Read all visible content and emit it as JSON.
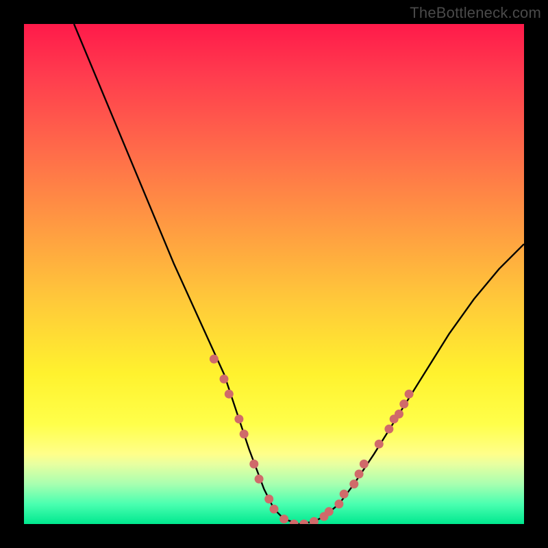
{
  "watermark": "TheBottleneck.com",
  "chart_data": {
    "type": "line",
    "title": "",
    "xlabel": "",
    "ylabel": "",
    "xlim": [
      0,
      100
    ],
    "ylim": [
      0,
      100
    ],
    "series": [
      {
        "name": "curve",
        "x": [
          10,
          15,
          20,
          25,
          30,
          35,
          40,
          45,
          48,
          50,
          52,
          55,
          58,
          60,
          63,
          66,
          70,
          75,
          80,
          85,
          90,
          95,
          100
        ],
        "y": [
          100,
          88,
          76,
          64,
          52,
          41,
          30,
          15,
          7,
          3,
          1,
          0,
          0.5,
          1.5,
          4,
          8,
          14,
          22,
          30,
          38,
          45,
          51,
          56
        ]
      }
    ],
    "scatter": {
      "name": "highlighted-points",
      "color": "#d06a6a",
      "points": [
        {
          "x": 38,
          "y": 33
        },
        {
          "x": 40,
          "y": 29
        },
        {
          "x": 41,
          "y": 26
        },
        {
          "x": 43,
          "y": 21
        },
        {
          "x": 44,
          "y": 18
        },
        {
          "x": 46,
          "y": 12
        },
        {
          "x": 47,
          "y": 9
        },
        {
          "x": 49,
          "y": 5
        },
        {
          "x": 50,
          "y": 3
        },
        {
          "x": 52,
          "y": 1
        },
        {
          "x": 54,
          "y": 0
        },
        {
          "x": 56,
          "y": 0
        },
        {
          "x": 58,
          "y": 0.5
        },
        {
          "x": 60,
          "y": 1.5
        },
        {
          "x": 61,
          "y": 2.5
        },
        {
          "x": 63,
          "y": 4
        },
        {
          "x": 64,
          "y": 6
        },
        {
          "x": 66,
          "y": 8
        },
        {
          "x": 67,
          "y": 10
        },
        {
          "x": 68,
          "y": 12
        },
        {
          "x": 71,
          "y": 16
        },
        {
          "x": 73,
          "y": 19
        },
        {
          "x": 74,
          "y": 21
        },
        {
          "x": 75,
          "y": 22
        },
        {
          "x": 76,
          "y": 24
        },
        {
          "x": 77,
          "y": 26
        }
      ]
    },
    "background": {
      "type": "vertical-gradient",
      "stops": [
        {
          "pos": 0,
          "color": "#ff1a4a"
        },
        {
          "pos": 25,
          "color": "#ff6a4a"
        },
        {
          "pos": 55,
          "color": "#ffc83a"
        },
        {
          "pos": 80,
          "color": "#ffff4a"
        },
        {
          "pos": 92,
          "color": "#a8ffb0"
        },
        {
          "pos": 100,
          "color": "#00e88f"
        }
      ]
    }
  }
}
